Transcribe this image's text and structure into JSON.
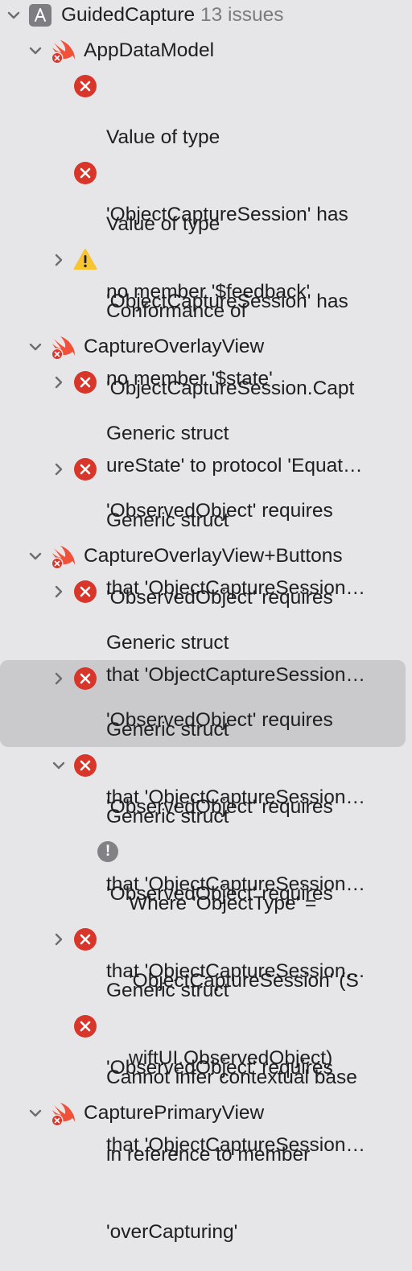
{
  "project": {
    "name": "GuidedCapture",
    "count": "13 issues"
  },
  "groups": [
    {
      "name": "AppDataModel",
      "issues": [
        {
          "lines": [
            "Value of type",
            "'ObjectCaptureSession' has",
            "no member '$feedback'"
          ]
        },
        {
          "lines": [
            "Value of type",
            "'ObjectCaptureSession' has",
            "no member '$state'"
          ]
        },
        {
          "lines": [
            "Conformance of",
            "'ObjectCaptureSession.Capt",
            "ureState' to protocol 'Equat…"
          ]
        }
      ]
    },
    {
      "name": "CaptureOverlayView",
      "issues": [
        {
          "lines": [
            "Generic struct",
            "'ObservedObject' requires",
            "that 'ObjectCaptureSession…"
          ]
        },
        {
          "lines": [
            "Generic struct",
            "'ObservedObject' requires",
            "that 'ObjectCaptureSession…"
          ]
        }
      ]
    },
    {
      "name": "CaptureOverlayView+Buttons",
      "issues": [
        {
          "lines": [
            "Generic struct",
            "'ObservedObject' requires",
            "that 'ObjectCaptureSession…"
          ]
        },
        {
          "lines": [
            "Generic struct",
            "'ObservedObject' requires",
            "that 'ObjectCaptureSession…"
          ]
        },
        {
          "lines": [
            "Generic struct",
            "'ObservedObject' requires",
            "that 'ObjectCaptureSession…"
          ],
          "note": {
            "lines": [
              "Where 'ObjectType' =",
              "'ObjectCaptureSession' (S",
              "wiftUI.ObservedObject)"
            ]
          }
        },
        {
          "lines": [
            "Generic struct",
            "'ObservedObject' requires",
            "that 'ObjectCaptureSession…"
          ]
        },
        {
          "lines": [
            "Cannot infer contextual base",
            "in reference to member",
            "'overCapturing'"
          ]
        }
      ]
    },
    {
      "name": "CapturePrimaryView"
    }
  ],
  "icons": {
    "project": "xcode-project-icon",
    "file": "swift-file-error-icon",
    "error": "error-icon",
    "warning": "warning-icon",
    "note": "note-icon",
    "disclosure_open": "chevron-down-icon",
    "disclosure_closed": "chevron-right-icon"
  },
  "colors": {
    "error": "#d9362b",
    "warning": "#f7c531",
    "swift": "#f05138",
    "selection": "#cacacc",
    "background": "#e6e5e7"
  }
}
